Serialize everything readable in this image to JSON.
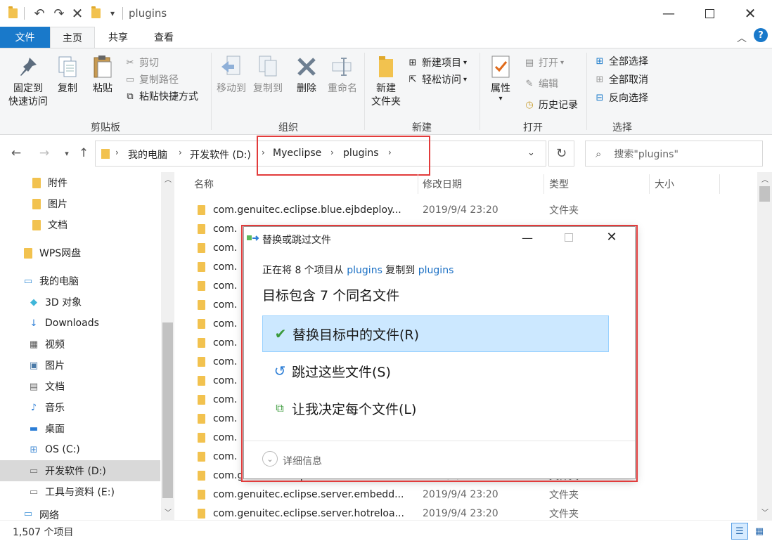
{
  "window": {
    "title": "plugins"
  },
  "tabs": [
    {
      "label": "文件"
    },
    {
      "label": "主页"
    },
    {
      "label": "共享"
    },
    {
      "label": "查看"
    }
  ],
  "ribbon": {
    "clipboard": {
      "label": "剪贴板",
      "pin": "固定到",
      "pin2": "快速访问",
      "copy": "复制",
      "paste": "粘贴",
      "cut": "剪切",
      "copy_path": "复制路径",
      "paste_shortcut": "粘贴快捷方式"
    },
    "organize": {
      "label": "组织",
      "move_to": "移动到",
      "copy_to": "复制到",
      "delete": "删除",
      "rename": "重命名"
    },
    "new": {
      "label": "新建",
      "new_folder": "新建",
      "new_folder2": "文件夹",
      "new_item": "新建项目",
      "easy_access": "轻松访问"
    },
    "open": {
      "label": "打开",
      "properties": "属性",
      "open": "打开",
      "edit": "编辑",
      "history": "历史记录"
    },
    "select": {
      "label": "选择",
      "select_all": "全部选择",
      "select_none": "全部取消",
      "invert": "反向选择"
    }
  },
  "address": {
    "crumbs": [
      "我的电脑",
      "开发软件 (D:)",
      "Myeclipse",
      "plugins"
    ],
    "search_placeholder": "搜索\"plugins\""
  },
  "nav": {
    "items": [
      {
        "label": "附件"
      },
      {
        "label": "图片"
      },
      {
        "label": "文档"
      },
      {
        "label": "WPS网盘"
      },
      {
        "label": "我的电脑"
      },
      {
        "label": "3D 对象"
      },
      {
        "label": "Downloads"
      },
      {
        "label": "视频"
      },
      {
        "label": "图片"
      },
      {
        "label": "文档"
      },
      {
        "label": "音乐"
      },
      {
        "label": "桌面"
      },
      {
        "label": "OS (C:)"
      },
      {
        "label": "开发软件 (D:)"
      },
      {
        "label": "工具与资料 (E:)"
      },
      {
        "label": "网络"
      }
    ]
  },
  "columns": {
    "name": "名称",
    "date": "修改日期",
    "type": "类型",
    "size": "大小"
  },
  "files": [
    {
      "name": "com.genuitec.eclipse.blue.ejbdeploy...",
      "date": "2019/9/4 23:20",
      "type": "文件夹"
    },
    {
      "name": "com.",
      "date": "",
      "type": ""
    },
    {
      "name": "com.",
      "date": "",
      "type": ""
    },
    {
      "name": "com.",
      "date": "",
      "type": ""
    },
    {
      "name": "com.",
      "date": "",
      "type": ""
    },
    {
      "name": "com.",
      "date": "",
      "type": ""
    },
    {
      "name": "com.",
      "date": "",
      "type": ""
    },
    {
      "name": "com.",
      "date": "",
      "type": ""
    },
    {
      "name": "com.",
      "date": "",
      "type": ""
    },
    {
      "name": "com.",
      "date": "",
      "type": ""
    },
    {
      "name": "com.",
      "date": "",
      "type": ""
    },
    {
      "name": "com.",
      "date": "",
      "type": ""
    },
    {
      "name": "com.",
      "date": "",
      "type": ""
    },
    {
      "name": "com.",
      "date": "",
      "type": ""
    },
    {
      "name": "com.genuitec.eclipse.server.embedd...",
      "date": "2019/9/4 23:20",
      "type": "文件夹"
    },
    {
      "name": "com.genuitec.eclipse.server.embedd...",
      "date": "2019/9/4 23:20",
      "type": "文件夹"
    },
    {
      "name": "com.genuitec.eclipse.server.hotreloa...",
      "date": "2019/9/4 23:20",
      "type": "文件夹"
    }
  ],
  "status": {
    "count": "1,507 个项目"
  },
  "dialog": {
    "title": "替换或跳过文件",
    "line_prefix": "正在将 8 个项目从 ",
    "from": "plugins",
    "line_mid": " 复制到 ",
    "to": "plugins",
    "heading": "目标包含 7 个同名文件",
    "opt_replace": "替换目标中的文件(R)",
    "opt_skip": "跳过这些文件(S)",
    "opt_decide": "让我决定每个文件(L)",
    "details": "详细信息"
  },
  "colors": {
    "accent": "#1979ca",
    "highlight": "#e23b3b",
    "select": "#cce8ff",
    "link": "#1a6fc4"
  }
}
